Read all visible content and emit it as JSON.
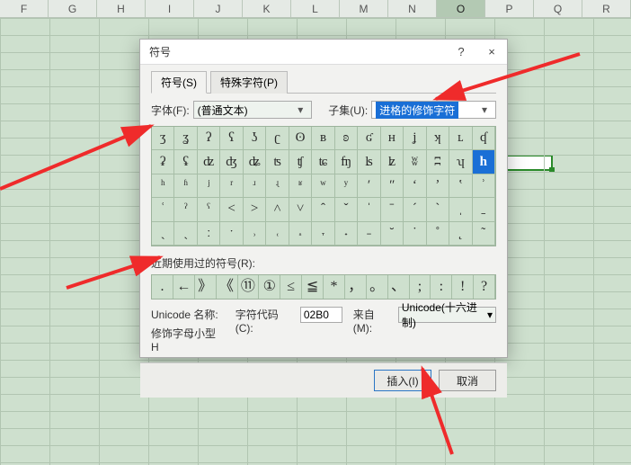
{
  "columns": [
    "F",
    "G",
    "H",
    "I",
    "J",
    "K",
    "L",
    "M",
    "N",
    "O",
    "P",
    "Q",
    "R"
  ],
  "selectedColumnIndex": 9,
  "dialog": {
    "title": "符号",
    "helpGlyph": "?",
    "closeGlyph": "×",
    "tabs": {
      "symbols": "符号(S)",
      "special": "特殊字符(P)"
    },
    "fontLabel": "字体(F):",
    "fontValue": "(普通文本)",
    "subsetLabel": "子集(U):",
    "subsetValue": "进格的修饰字符",
    "grid": [
      [
        "ʒ",
        "ʓ",
        "ʔ",
        "ʕ",
        "ʖ",
        "ʗ",
        "ʘ",
        "ʙ",
        "ʚ",
        "ʛ",
        "ʜ",
        "ʝ",
        "ʞ",
        "ʟ",
        "ʠ"
      ],
      [
        "ʡ",
        "ʢ",
        "ʣ",
        "ʤ",
        "ʥ",
        "ʦ",
        "ʧ",
        "ʨ",
        "ʩ",
        "ʪ",
        "ʫ",
        "ʬ",
        "ʭ",
        "ʮ",
        "ʯ"
      ],
      [
        "ʰ",
        "ʱ",
        "ʲ",
        "ʳ",
        "ʴ",
        "ʵ",
        "ʶ",
        "ʷ",
        "ʸ",
        "ʹ",
        "ʺ",
        "ʻ",
        "ʼ",
        "ʽ",
        "ʾ"
      ],
      [
        "ʿ",
        "ˀ",
        "ˁ",
        "˂",
        "˃",
        "˄",
        "˅",
        "ˆ",
        "ˇ",
        "ˈ",
        "ˉ",
        "ˊ",
        "ˋ",
        "ˌ",
        "ˍ"
      ],
      [
        "ˎ",
        "ˏ",
        "ː",
        "ˑ",
        "˒",
        "˓",
        "˔",
        "˕",
        "˖",
        "˗",
        "˘",
        "˙",
        "˚",
        "˛",
        "˜"
      ]
    ],
    "selectedCell": {
      "row": 1,
      "col": 14,
      "glyph": "h"
    },
    "recentLabel": "近期使用过的符号(R):",
    "recent": [
      ".",
      "←",
      "》",
      "《",
      "⑪",
      "①",
      "≤",
      "≦",
      "*",
      "，",
      "。",
      "、",
      ";",
      ":",
      "!",
      "?"
    ],
    "unicodeNameLabel": "Unicode 名称:",
    "unicodeName": "修饰字母小型 H",
    "charCodeLabel": "字符代码(C):",
    "charCodeValue": "02B0",
    "fromLabel": "来自(M):",
    "fromValue": "Unicode(十六进制)",
    "insertLabel": "插入(I)",
    "cancelLabel": "取消"
  }
}
